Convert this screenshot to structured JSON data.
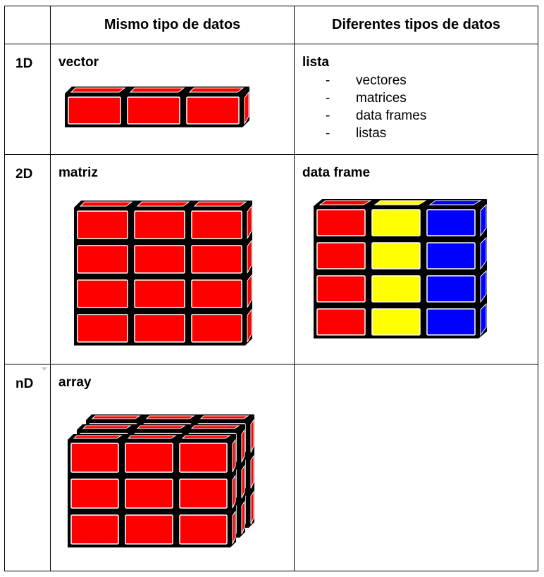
{
  "table": {
    "header": {
      "corner": "",
      "same_type": "Mismo tipo de datos",
      "different_types": "Diferentes tipos de datos"
    },
    "rows": [
      {
        "dimension": "1D",
        "same": {
          "title": "vector",
          "diagram": "vector-blocks",
          "rows": 1,
          "cols": 3,
          "layers": 1,
          "colors": [
            "#ff0000"
          ]
        },
        "different": {
          "title": "lista",
          "items": [
            "vectores",
            "matrices",
            "data frames",
            "listas"
          ]
        }
      },
      {
        "dimension": "2D",
        "same": {
          "title": "matriz",
          "diagram": "matrix-blocks",
          "rows": 4,
          "cols": 3,
          "layers": 1,
          "colors": [
            "#ff0000"
          ]
        },
        "different": {
          "title": "data frame",
          "diagram": "data-frame-blocks",
          "rows": 4,
          "cols": 3,
          "column_colors": [
            "#ff0000",
            "#ffff00",
            "#0000ff"
          ]
        }
      },
      {
        "dimension": "nD",
        "same": {
          "title": "array",
          "diagram": "array-blocks",
          "rows": 3,
          "cols": 3,
          "layers": 3,
          "colors": [
            "#ff0000"
          ]
        },
        "different": {
          "title": ""
        }
      }
    ]
  }
}
